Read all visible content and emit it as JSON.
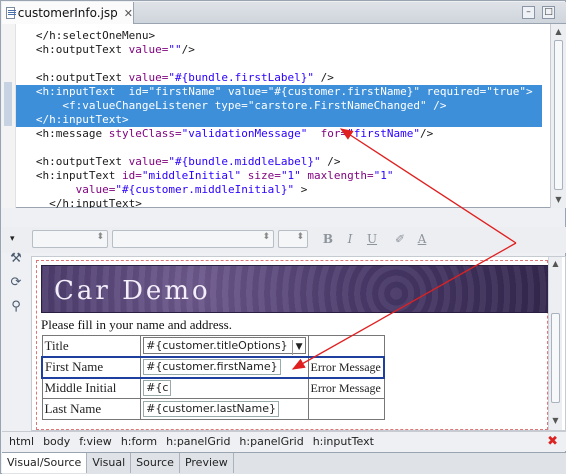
{
  "editor_tab": {
    "filename": "customerInfo.jsp",
    "close": "✕"
  },
  "window_buttons": {
    "minimize": "–",
    "maximize": "□"
  },
  "source_lines": [
    {
      "indent": "   ",
      "parts": [
        [
          "t",
          "</h:selectOneMenu>"
        ]
      ]
    },
    {
      "indent": "   ",
      "parts": [
        [
          "t",
          "<h:outputText "
        ],
        [
          "a",
          "value="
        ],
        [
          "v",
          "\"\""
        ],
        [
          "t",
          "/>"
        ]
      ]
    },
    {
      "indent": "",
      "parts": []
    },
    {
      "indent": "   ",
      "parts": [
        [
          "t",
          "<h:outputText "
        ],
        [
          "a",
          "value="
        ],
        [
          "v",
          "\"#{bundle.firstLabel}\""
        ],
        [
          "t",
          " />"
        ]
      ]
    },
    {
      "indent": "   ",
      "parts": [
        [
          "t",
          "<h:inputText  "
        ],
        [
          "a",
          "id="
        ],
        [
          "v",
          "\"firstName\""
        ],
        [
          "a",
          " value="
        ],
        [
          "v",
          "\"#{customer.firstName}\""
        ],
        [
          "a",
          " required="
        ],
        [
          "v",
          "\"true\""
        ],
        [
          "t",
          ">"
        ]
      ]
    },
    {
      "indent": "       ",
      "parts": [
        [
          "t",
          "<f:valueChangeListener "
        ],
        [
          "a",
          "type="
        ],
        [
          "v",
          "\"carstore.FirstNameChanged\""
        ],
        [
          "t",
          " />"
        ]
      ]
    },
    {
      "indent": "   ",
      "parts": [
        [
          "t",
          "</h:inputText>"
        ]
      ]
    },
    {
      "indent": "   ",
      "parts": [
        [
          "t",
          "<h:message "
        ],
        [
          "a",
          "styleClass="
        ],
        [
          "v",
          "\"validationMessage\""
        ],
        [
          "a",
          "  for="
        ],
        [
          "v",
          "\"firstName\""
        ],
        [
          "t",
          "/>"
        ]
      ]
    },
    {
      "indent": "",
      "parts": []
    },
    {
      "indent": "   ",
      "parts": [
        [
          "t",
          "<h:outputText "
        ],
        [
          "a",
          "value="
        ],
        [
          "v",
          "\"#{bundle.middleLabel}\""
        ],
        [
          "t",
          " />"
        ]
      ]
    },
    {
      "indent": "   ",
      "parts": [
        [
          "t",
          "<h:inputText "
        ],
        [
          "a",
          "id="
        ],
        [
          "v",
          "\"middleInitial\""
        ],
        [
          "a",
          " size="
        ],
        [
          "v",
          "\"1\""
        ],
        [
          "a",
          " maxlength="
        ],
        [
          "v",
          "\"1\""
        ]
      ]
    },
    {
      "indent": "         ",
      "parts": [
        [
          "a",
          "value="
        ],
        [
          "v",
          "\"#{customer.middleInitial}\""
        ],
        [
          "t",
          " >"
        ]
      ]
    },
    {
      "indent": "     ",
      "parts": [
        [
          "t",
          "</h:inputText>"
        ]
      ]
    }
  ],
  "highlighted_lines": [
    4,
    5,
    6
  ],
  "format_toolbar": {
    "bold": "B",
    "italic": "I",
    "underline": "U",
    "clear": "✐",
    "font_color": "A"
  },
  "tools": {
    "view_menu": "▾",
    "tool1": "⚒",
    "tool2": "⟳",
    "tool3": "⚲"
  },
  "canvas": {
    "banner_title": "Car Demo",
    "prompt": "Please fill in your name and address.",
    "rows": [
      {
        "label": "Title",
        "field": "#{customer.titleOptions}",
        "kind": "select",
        "message": ""
      },
      {
        "label": "First Name",
        "field": "#{customer.firstName}",
        "kind": "input",
        "message": "Error Message"
      },
      {
        "label": "Middle Initial",
        "field": "#{c",
        "kind": "input",
        "message": "Error Message"
      },
      {
        "label": "Last Name",
        "field": "#{customer.lastName}",
        "kind": "input",
        "message": ""
      }
    ],
    "selected_row": 1
  },
  "breadcrumbs": [
    "html",
    "body",
    "f:view",
    "h:form",
    "h:panelGrid",
    "h:panelGrid",
    "h:inputText"
  ],
  "bottom_tabs": [
    {
      "label": "Visual/Source",
      "active": true
    },
    {
      "label": "Visual",
      "active": false
    },
    {
      "label": "Source",
      "active": false
    },
    {
      "label": "Preview",
      "active": false
    }
  ],
  "annotation_color": "#e02020",
  "selection_color": "#3d8fd9"
}
